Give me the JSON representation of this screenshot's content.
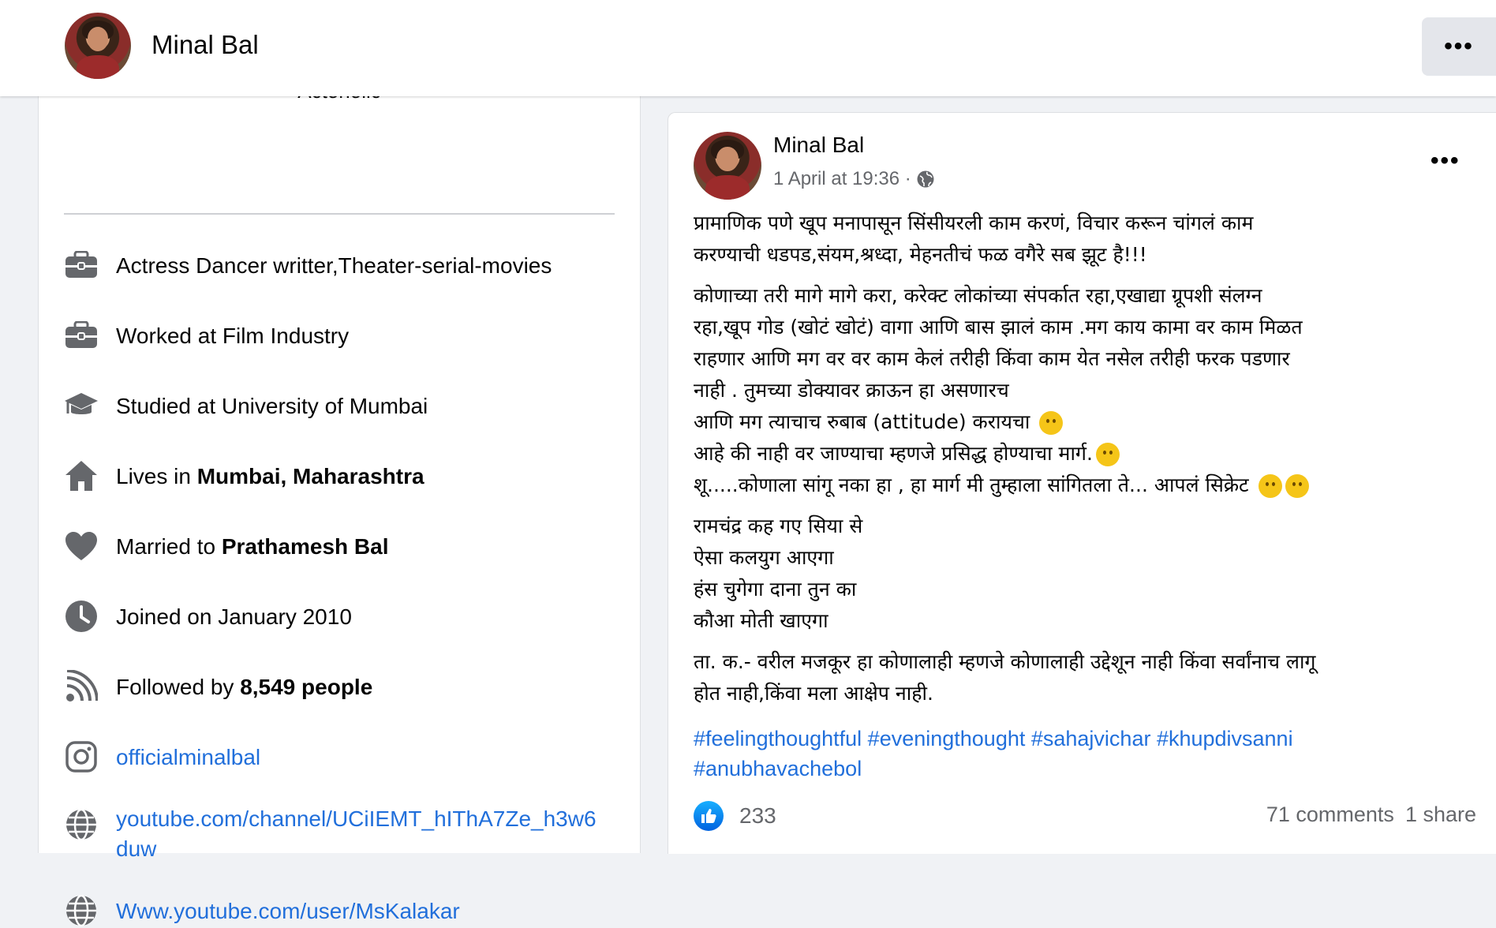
{
  "header": {
    "name": "Minal Bal",
    "more_label": "•••"
  },
  "intro": {
    "bio_partial": "Actoholic",
    "items": [
      {
        "icon": "briefcase-icon",
        "text": "Actress Dancer writter,Theater-serial-movies"
      },
      {
        "icon": "briefcase-icon",
        "text": "Worked at Film Industry"
      },
      {
        "icon": "graduation-cap-icon",
        "text": "Studied at University of Mumbai"
      },
      {
        "icon": "home-icon",
        "prefix": "Lives in ",
        "bold": "Mumbai, Maharashtra"
      },
      {
        "icon": "heart-icon",
        "prefix": "Married to ",
        "bold": "Prathamesh Bal"
      },
      {
        "icon": "clock-icon",
        "text": "Joined on January 2010"
      },
      {
        "icon": "rss-icon",
        "prefix": "Followed by ",
        "bold": "8,549 people"
      },
      {
        "icon": "instagram-icon",
        "link": "officialminalbal"
      },
      {
        "icon": "globe-icon",
        "link": "youtube.com/channel/UCiIEMT_hIThA7Ze_h3w6",
        "link2": "duw"
      },
      {
        "icon": "globe-icon",
        "link": "Www.youtube.com/user/MsKalakar"
      }
    ]
  },
  "post": {
    "author": "Minal Bal",
    "timestamp": "1 April at 19:36 ·",
    "more_label": "•••",
    "para1": [
      "प्रामाणिक पणे खूप मनापासून  सिंसीयरली काम करणं, विचार करून चांगलं काम",
      "करण्याची धडपड,संयम,श्रध्दा, मेहनतीचं फळ वगैरे सब झूट  है!!!"
    ],
    "para2": [
      "कोणाच्या तरी मागे मागे करा, करेक्ट लोकांच्या संपर्कात रहा,एखाद्या ग्रूपशी संलग्न",
      "रहा,खूप गोड (खोटं खोटं) वागा आणि बास झालं काम .मग काय कामा वर काम मिळत",
      "राहणार आणि मग वर वर काम केलं तरीही किंवा काम येत नसेल तरीही फरक पडणार",
      "नाही . तुमच्या डोक्यावर क्राऊन हा असणारच",
      "आणि मग त्याचाच रुबाब (attitude) करायचा",
      "आहे की नाही वर जाण्याचा म्हणजे प्रसिद्ध होण्याचा मार्ग.",
      "शू.....कोणाला सांगू नका हा , हा मार्ग मी तुम्हाला सांगितला ते... आपलं सिक्रेट"
    ],
    "para3": [
      "रामचंद्र कह गए सिया से",
      "ऐसा  कलयुग आएगा",
      "हंस चुगेगा दाना तुन का",
      "कौआ मोती खाएगा"
    ],
    "para4": [
      " ता. क.- वरील मजकूर हा कोणालाही म्हणजे कोणालाही उद्देशून नाही किंवा सर्वांनाच लागू",
      "होत नाही,किंवा मला आक्षेप नाही."
    ],
    "hashtags_line1": "#feelingthoughtful #eveningthought #sahajvichar #khupdivsanni",
    "hashtags_line2": "#anubhavachebol",
    "reaction_count": "233",
    "comments": "71 comments",
    "shares": "1 share"
  },
  "colors": {
    "link": "#216fdb",
    "secondary_text": "#65676b",
    "icon_gray": "#65676b",
    "like_blue": "#1877f2"
  }
}
